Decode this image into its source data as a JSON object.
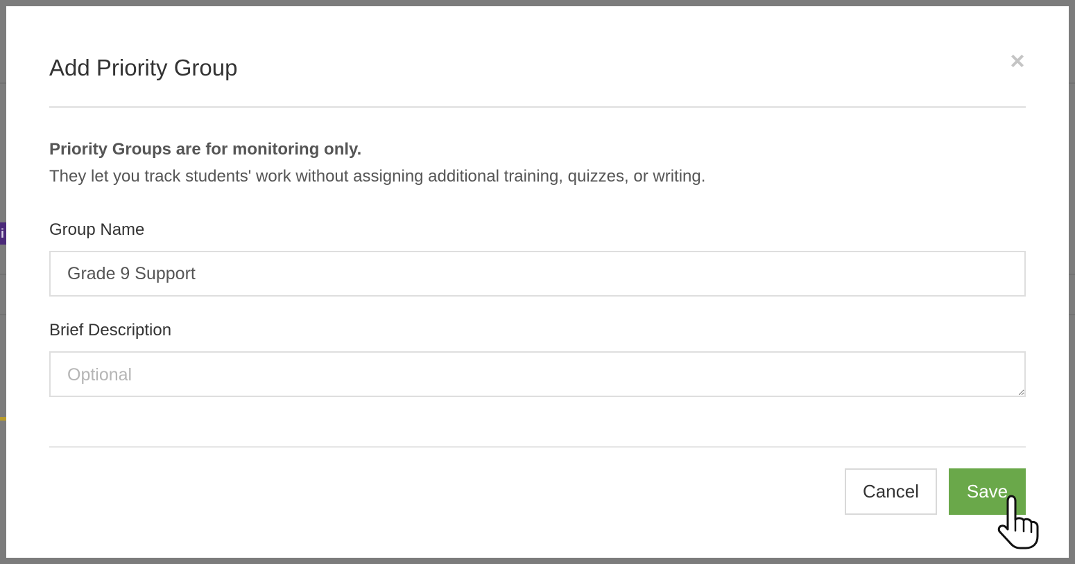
{
  "modal": {
    "title": "Add Priority Group",
    "close_icon": "close-icon",
    "notice": {
      "heading": "Priority Groups are for monitoring only.",
      "body": "They let you track students' work without assigning additional training, quizzes, or writing."
    },
    "form": {
      "group_name": {
        "label": "Group Name",
        "value": "Grade 9 Support"
      },
      "description": {
        "label": "Brief Description",
        "value": "",
        "placeholder": "Optional"
      }
    },
    "footer": {
      "cancel_label": "Cancel",
      "save_label": "Save"
    }
  },
  "background": {
    "chip_letter": "i"
  },
  "colors": {
    "overlay": "#7c7c7c",
    "save_button": "#6aa84a",
    "text_primary": "#333333",
    "text_secondary": "#555555",
    "placeholder": "#b5b5b5"
  },
  "icons": {
    "pointer": "hand-pointer-icon"
  }
}
